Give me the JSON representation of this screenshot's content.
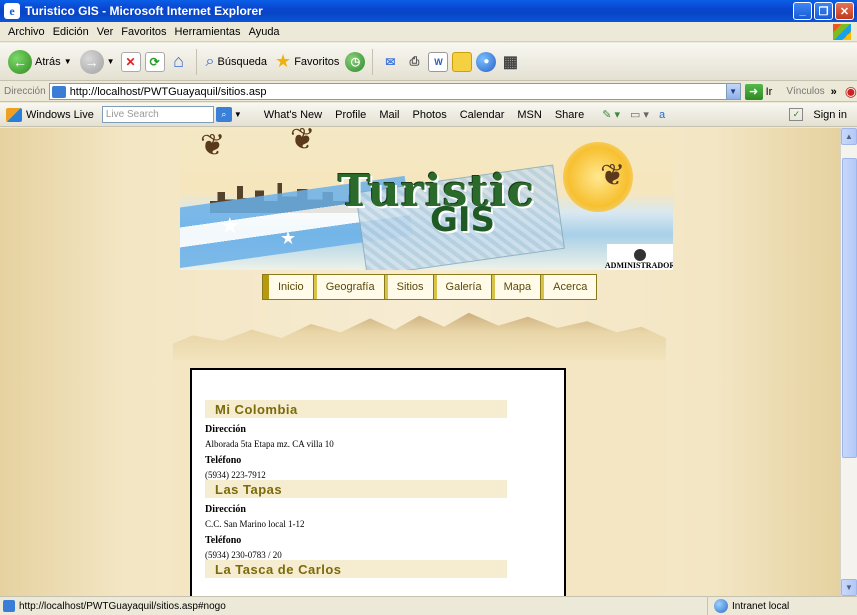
{
  "window": {
    "title": "Turistico GIS - Microsoft Internet Explorer"
  },
  "menu": [
    "Archivo",
    "Edición",
    "Ver",
    "Favoritos",
    "Herramientas",
    "Ayuda"
  ],
  "toolbar": {
    "back": "Atrás",
    "search": "Búsqueda",
    "favorites": "Favoritos"
  },
  "address": {
    "label": "Dirección",
    "url": "http://localhost/PWTGuayaquil/sitios.asp",
    "go": "Ir",
    "links": "Vínculos"
  },
  "live": {
    "brand": "Windows Live",
    "search_placeholder": "Live Search",
    "links": [
      "What's New",
      "Profile",
      "Mail",
      "Photos",
      "Calendar",
      "MSN",
      "Share"
    ],
    "sign_in": "Sign in"
  },
  "banner": {
    "logo": "Turistic",
    "logo2": "GIS",
    "admin": "ADMINISTRADOR"
  },
  "nav": [
    "Inicio",
    "Geografía",
    "Sitios",
    "Galería",
    "Mapa",
    "Acerca"
  ],
  "sites": [
    {
      "name": "Mi Colombia",
      "dir_label": "Dirección",
      "dir": "Alborada 5ta Etapa mz. CA villa 10",
      "tel_label": "Teléfono",
      "tel": "(5934) 223-7912"
    },
    {
      "name": "Las Tapas",
      "dir_label": "Dirección",
      "dir": "C.C. San Marino local 1-12",
      "tel_label": "Teléfono",
      "tel": "(5934) 230-0783 / 20"
    },
    {
      "name": "La Tasca de Carlos"
    }
  ],
  "status": {
    "text": "http://localhost/PWTGuayaquil/sitios.asp#nogo",
    "zone": "Intranet local"
  }
}
